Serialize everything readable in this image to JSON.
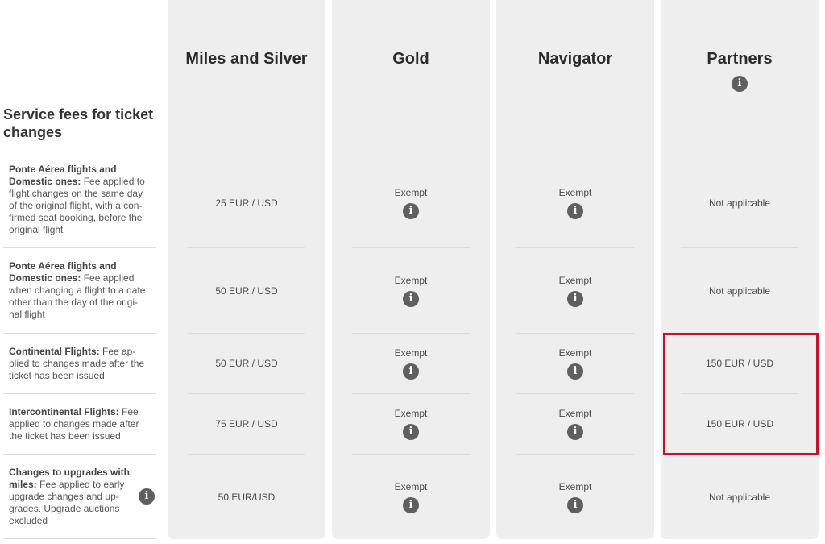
{
  "title": "Service fees for ticket changes",
  "tiers": [
    "Miles and Silver",
    "Gold",
    "Navigator",
    "Partners"
  ],
  "rows": [
    {
      "label_bold": "Ponte Aérea flights and Domestic ones:",
      "label_rest": " Fee applied to flight changes on the same day of the original flight, with a con-firmed seat booking, before the original flight",
      "values": [
        "25 EUR / USD",
        "Exempt",
        "Exempt",
        "Not applicable"
      ]
    },
    {
      "label_bold": "Ponte Aérea flights and Domestic ones:",
      "label_rest": " Fee applied when changing a flight to a date other than the day of the origi-nal flight",
      "values": [
        "50 EUR / USD",
        "Exempt",
        "Exempt",
        "Not applicable"
      ]
    },
    {
      "label_bold": "Continental Flights:",
      "label_rest": " Fee ap-plied to changes made after the ticket has been issued",
      "values": [
        "50 EUR / USD",
        "Exempt",
        "Exempt",
        "150 EUR / USD"
      ]
    },
    {
      "label_bold": "Intercontinental Flights:",
      "label_rest": " Fee applied to changes made after the ticket has been issued",
      "values": [
        "75 EUR / USD",
        "Exempt",
        "Exempt",
        "150 EUR / USD"
      ]
    },
    {
      "label_bold": "Changes to upgrades with miles:",
      "label_rest": " Fee applied to early upgrade changes and up-grades. Upgrade auctions excluded",
      "values": [
        "50 EUR/USD",
        "Exempt",
        "Exempt",
        "Not applicable"
      ]
    }
  ],
  "icons": {
    "info": "i"
  },
  "colors": {
    "column_bg": "#eeeeee",
    "highlight": "#c8102e",
    "info_icon": "#5f5f5f"
  }
}
